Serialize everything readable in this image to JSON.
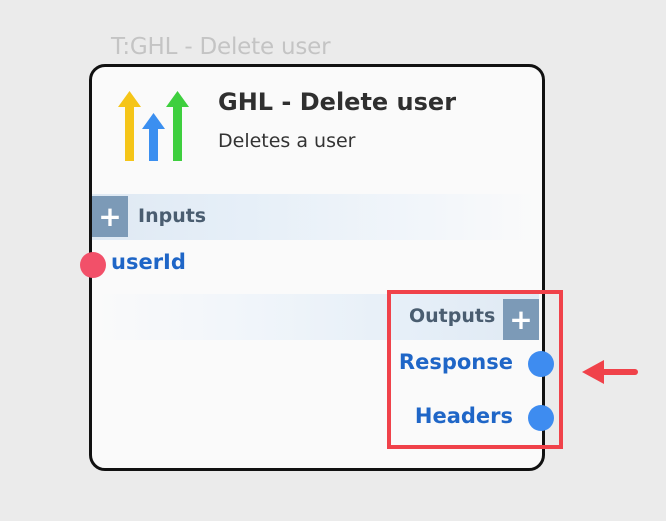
{
  "node": {
    "caption": "T:GHL - Delete user",
    "title": "GHL - Delete user",
    "description": "Deletes a user",
    "logo_icon": "ghl-logo-icon"
  },
  "inputs": {
    "label": "Inputs",
    "add_label": "+",
    "items": [
      {
        "label": "userId",
        "port_color": "#f25069"
      }
    ]
  },
  "outputs": {
    "label": "Outputs",
    "add_label": "+",
    "items": [
      {
        "label": "Response",
        "port_color": "#3e8cf0"
      },
      {
        "label": "Headers",
        "port_color": "#3e8cf0"
      }
    ]
  },
  "annotation": {
    "highlight_color": "#f0424a",
    "icon": "arrow-left-icon"
  },
  "colors": {
    "canvas": "#ebebeb",
    "card": "#fafafa",
    "section_button": "#7c9ab7",
    "port_label": "#1f66c7"
  }
}
